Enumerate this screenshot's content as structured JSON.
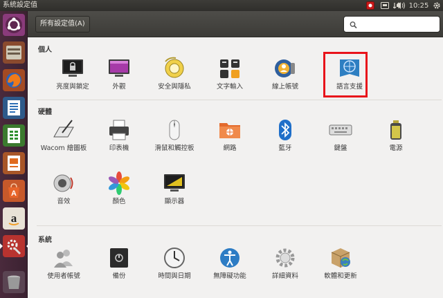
{
  "topbar": {
    "window_title": "系統設定值",
    "time": "10:25",
    "icons": [
      "record-indicator-icon",
      "keyboard-layout-icon",
      "network-icon",
      "volume-icon",
      "gear-icon"
    ]
  },
  "launcher": {
    "items": [
      "ubuntu-dash-icon",
      "files-icon",
      "firefox-icon",
      "writer-icon",
      "calc-icon",
      "impress-icon",
      "software-center-icon",
      "amazon-icon",
      "system-settings-icon",
      "trash-icon"
    ]
  },
  "toolbar": {
    "all_settings_label": "所有設定值(A)",
    "search_placeholder": ""
  },
  "sections": {
    "personal": {
      "title": "個人",
      "items": [
        "亮度與鎖定",
        "外觀",
        "安全與隱私",
        "文字輸入",
        "線上帳號",
        "語言支援"
      ]
    },
    "hardware": {
      "title": "硬體",
      "items": [
        "Wacom 繪圖板",
        "印表機",
        "滑鼠和觸控板",
        "網路",
        "藍牙",
        "鍵盤",
        "電源",
        "音效",
        "顏色",
        "顯示器"
      ]
    },
    "system": {
      "title": "系統",
      "items": [
        "使用者帳號",
        "備份",
        "時間與日期",
        "無障礙功能",
        "詳細資料",
        "軟體和更新"
      ]
    }
  },
  "highlighted_item": "語言支援",
  "colors": {
    "highlight_box": "#e8131a",
    "launcher_bg": "#4a2a3c",
    "toolbar_bg": "#3c3b37"
  }
}
